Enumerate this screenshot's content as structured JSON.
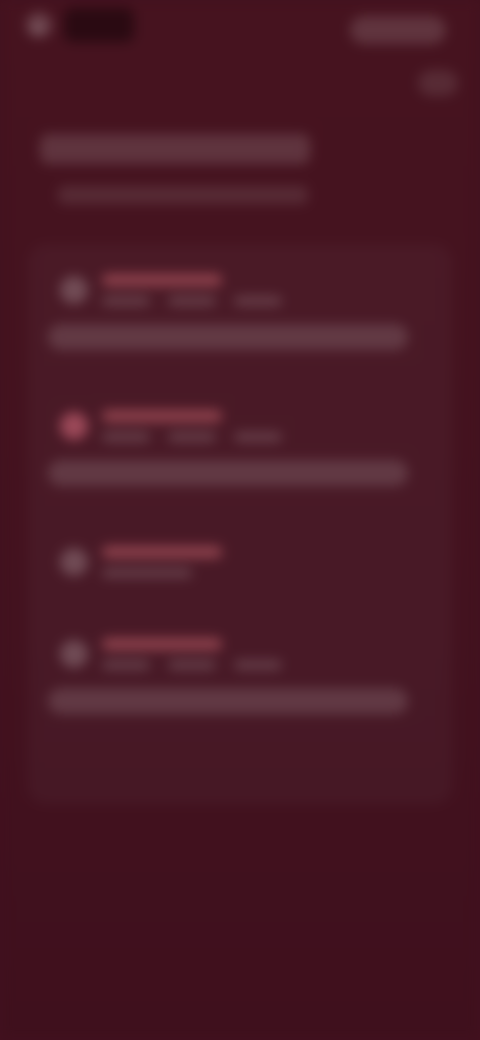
{
  "topbar": {
    "back_icon": "←",
    "app_title": "",
    "primary_action": "",
    "secondary_action": ""
  },
  "page": {
    "title": "",
    "subtitle": ""
  },
  "cards": [
    {
      "label": "",
      "meta": [
        "",
        "",
        ""
      ],
      "bar": ""
    },
    {
      "label": "",
      "meta": [
        "",
        "",
        ""
      ],
      "bar": ""
    },
    {
      "label": "",
      "meta": [
        ""
      ],
      "bar": ""
    },
    {
      "label": "",
      "meta": [
        "",
        "",
        ""
      ],
      "bar": ""
    }
  ],
  "colors": {
    "background": "#42111f",
    "accent": "#d46a7e"
  }
}
